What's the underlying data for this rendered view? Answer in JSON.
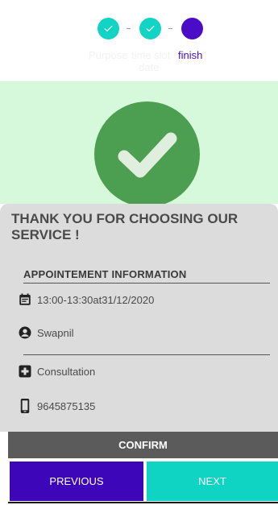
{
  "stepper": {
    "steps": [
      {
        "label": "Purpose",
        "status": "done",
        "icon": "check-icon"
      },
      {
        "label": "time slot",
        "status": "done",
        "icon": "check-icon"
      },
      {
        "label": "finish",
        "status": "current",
        "icon": "dot"
      }
    ],
    "wrapped_label": "date",
    "colors": {
      "done": "#12d4c4",
      "current": "#4b0cc7"
    }
  },
  "success": {
    "icon": "success-check-icon",
    "color": "#4c9f50",
    "background": "#d6f9dc"
  },
  "card": {
    "title": "THANK YOU FOR CHOOSING OUR SERVICE !",
    "section_title": "APPOINTEMENT INFORMATION",
    "appointment_time": "13:00-13:30at31/12/2020",
    "name": "Swapnil",
    "service": "Consultation",
    "phone": "9645875135"
  },
  "actions": {
    "confirm_label": "CONFIRM",
    "previous_label": "PREVIOUS",
    "next_label": "NEXT"
  }
}
